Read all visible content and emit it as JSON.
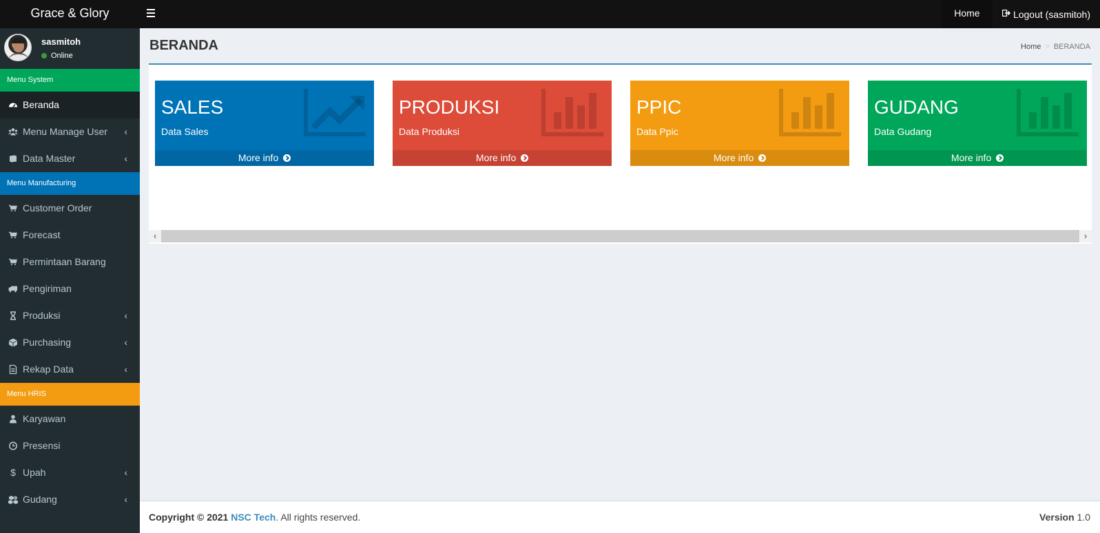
{
  "header": {
    "brand": "Grace & Glory",
    "nav_home": "Home",
    "nav_logout": "Logout (sasmitoh)"
  },
  "user": {
    "name": "sasmitoh",
    "status": "Online"
  },
  "sidebar": {
    "section_system": "Menu System",
    "section_manufacturing": "Menu Manufacturing",
    "section_hris": "Menu HRIS",
    "items": [
      {
        "label": "Beranda",
        "icon": "dashboard-icon"
      },
      {
        "label": "Menu Manage User",
        "icon": "users-icon"
      },
      {
        "label": "Data Master",
        "icon": "book-icon"
      },
      {
        "label": "Customer Order",
        "icon": "cart-icon"
      },
      {
        "label": "Forecast",
        "icon": "cart-icon"
      },
      {
        "label": "Permintaan Barang",
        "icon": "cart-icon"
      },
      {
        "label": "Pengiriman",
        "icon": "truck-icon"
      },
      {
        "label": "Produksi",
        "icon": "hourglass-icon"
      },
      {
        "label": "Purchasing",
        "icon": "cube-icon"
      },
      {
        "label": "Rekap Data",
        "icon": "file-icon"
      },
      {
        "label": "Karyawan",
        "icon": "user-icon"
      },
      {
        "label": "Presensi",
        "icon": "clock-icon"
      },
      {
        "label": "Upah",
        "icon": "dollar-icon"
      },
      {
        "label": "Gudang",
        "icon": "cubes-icon"
      }
    ]
  },
  "page": {
    "title": "BERANDA",
    "breadcrumb_home": "Home",
    "breadcrumb_sep": ">",
    "breadcrumb_current": "BERANDA"
  },
  "cards": [
    {
      "title": "SALES",
      "subtitle": "Data Sales",
      "more": "More info",
      "color": "#0073b7",
      "icon": "line-chart-icon"
    },
    {
      "title": "PRODUKSI",
      "subtitle": "Data Produksi",
      "more": "More info",
      "color": "#dd4b39",
      "icon": "bar-chart-icon"
    },
    {
      "title": "PPIC",
      "subtitle": "Data Ppic",
      "more": "More info",
      "color": "#f39c12",
      "icon": "bar-chart-icon"
    },
    {
      "title": "GUDANG",
      "subtitle": "Data Gudang",
      "more": "More info",
      "color": "#00a65a",
      "icon": "bar-chart-icon"
    }
  ],
  "footer": {
    "copyright": "Copyright © 2021",
    "company": "NSC Tech",
    "rights": ". All rights reserved.",
    "version_label": "Version",
    "version": "1.0"
  }
}
